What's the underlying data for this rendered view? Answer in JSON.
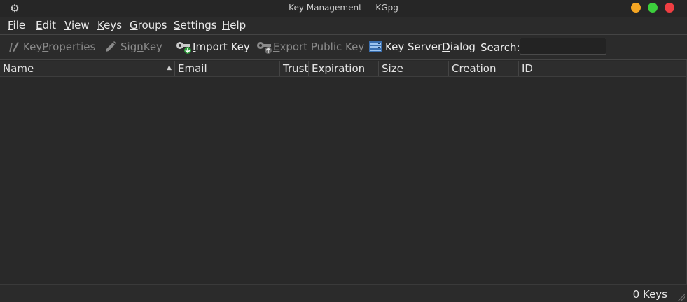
{
  "window": {
    "title": "Key Management — KGpg",
    "app_icon": "gear-icon"
  },
  "menu": [
    {
      "pre": "",
      "u": "F",
      "post": "ile"
    },
    {
      "pre": "",
      "u": "E",
      "post": "dit"
    },
    {
      "pre": "",
      "u": "V",
      "post": "iew"
    },
    {
      "pre": "",
      "u": "K",
      "post": "eys"
    },
    {
      "pre": "",
      "u": "G",
      "post": "roups"
    },
    {
      "pre": "",
      "u": "S",
      "post": "ettings"
    },
    {
      "pre": "",
      "u": "H",
      "post": "elp"
    }
  ],
  "toolbar": {
    "key_properties": {
      "pre": "Key ",
      "u": "P",
      "post": "roperties",
      "icon": "key-properties-icon"
    },
    "sign_key": {
      "pre": "Sig",
      "u": "n",
      "post": " Key",
      "icon": "pencil-icon"
    },
    "import_key": {
      "pre": "",
      "u": "I",
      "post": "mport Key",
      "icon": "import-key-icon"
    },
    "export_public_key": {
      "pre": "",
      "u": "E",
      "post": "xport Public Key",
      "icon": "export-key-icon"
    },
    "key_server_dialog": {
      "pre": "Key Server ",
      "u": "D",
      "post": "ialog",
      "icon": "key-server-icon"
    },
    "search_label": "Search:",
    "search_value": ""
  },
  "table": {
    "columns": [
      "Name",
      "Email",
      "Trust",
      "Expiration",
      "Size",
      "Creation",
      "ID"
    ],
    "sorted_column": "Name",
    "rows": []
  },
  "status": {
    "text": "0 Keys"
  },
  "colors": {
    "minimize": "#f5a623",
    "maximize": "#3ccf3c",
    "close": "#ef3e42",
    "background": "#2a2a2a"
  }
}
